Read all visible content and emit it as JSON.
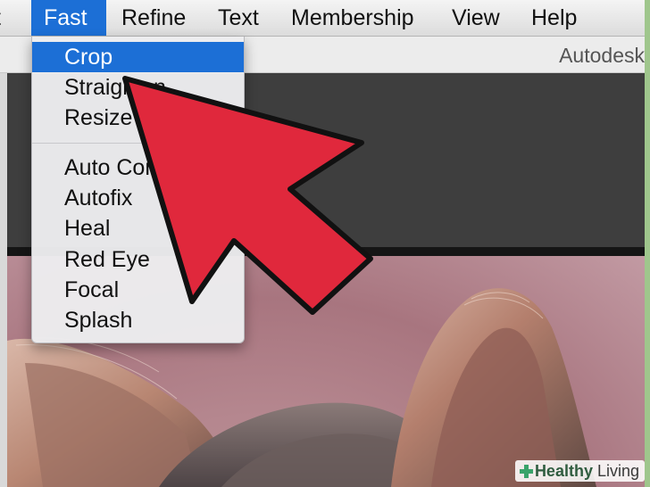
{
  "menubar": {
    "items": [
      {
        "label": "t",
        "active": false
      },
      {
        "label": "Fast",
        "active": true
      },
      {
        "label": "Refine",
        "active": false
      },
      {
        "label": "Text",
        "active": false
      },
      {
        "label": "Membership",
        "active": false
      },
      {
        "label": "View",
        "active": false
      },
      {
        "label": "Help",
        "active": false
      }
    ]
  },
  "titlebar": {
    "title": "Autodesk"
  },
  "dropdown": {
    "items": [
      {
        "label": "Crop",
        "selected": true
      },
      {
        "label": "Straighten"
      },
      {
        "label": "Resize"
      },
      {
        "label": "Auto Contrast"
      },
      {
        "label": "Autofix"
      },
      {
        "label": "Heal"
      },
      {
        "label": "Red Eye"
      },
      {
        "label": "Focal"
      },
      {
        "label": "Splash"
      }
    ]
  },
  "watermark": {
    "brand_bold": "Healthy",
    "brand_rest": " Living"
  },
  "colors": {
    "accent": "#1c6fd6",
    "arrow": "#e0283c",
    "frame": "#9fc68c"
  }
}
